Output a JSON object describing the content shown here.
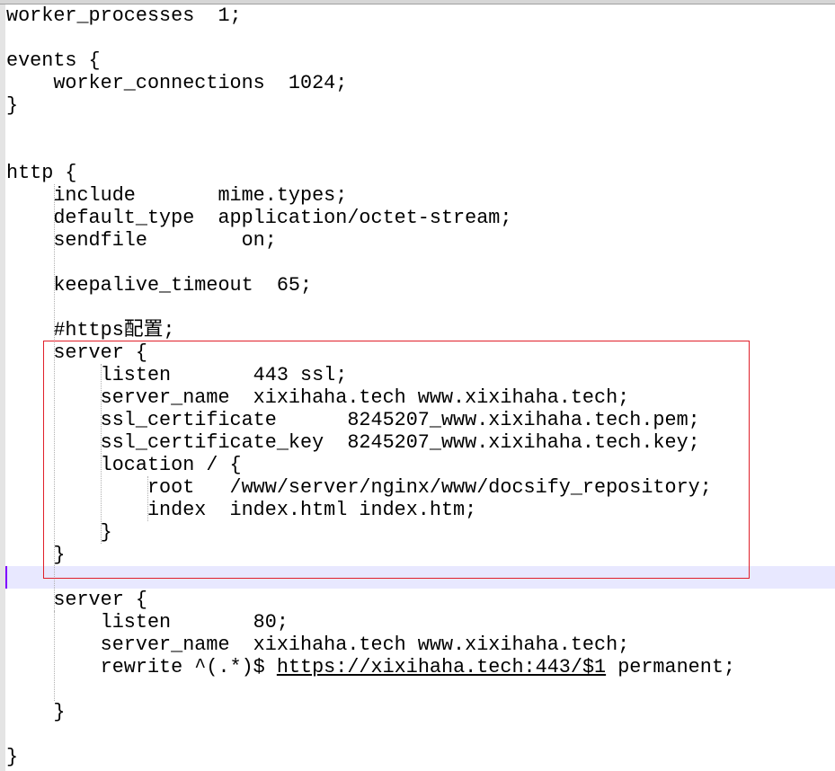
{
  "editor": {
    "current_line": 26,
    "lines": [
      "worker_processes  1;",
      "",
      "events {",
      "    worker_connections  1024;",
      "}",
      "",
      "",
      "http {",
      "    include       mime.types;",
      "    default_type  application/octet-stream;",
      "    sendfile        on;",
      "",
      "    keepalive_timeout  65;",
      "",
      "    #https配置;",
      "    server {",
      "        listen       443 ssl;",
      "        server_name  xixihaha.tech www.xixihaha.tech;",
      "        ssl_certificate      8245207_www.xixihaha.tech.pem;",
      "        ssl_certificate_key  8245207_www.xixihaha.tech.key;",
      "        location / {",
      "            root   /www/server/nginx/www/docsify_repository;",
      "            index  index.html index.htm;",
      "        }",
      "    }",
      "",
      "    server {",
      "        listen       80;",
      "        server_name  xixihaha.tech www.xixihaha.tech;",
      "        rewrite ^(.*)$ https://xixihaha.tech:443/$1 permanent;",
      "",
      "    }",
      "",
      "}"
    ],
    "link_text": "https://xixihaha.tech:443/$1",
    "highlight_box_color": "#e0202a",
    "current_line_color": "#e8e8ff"
  }
}
